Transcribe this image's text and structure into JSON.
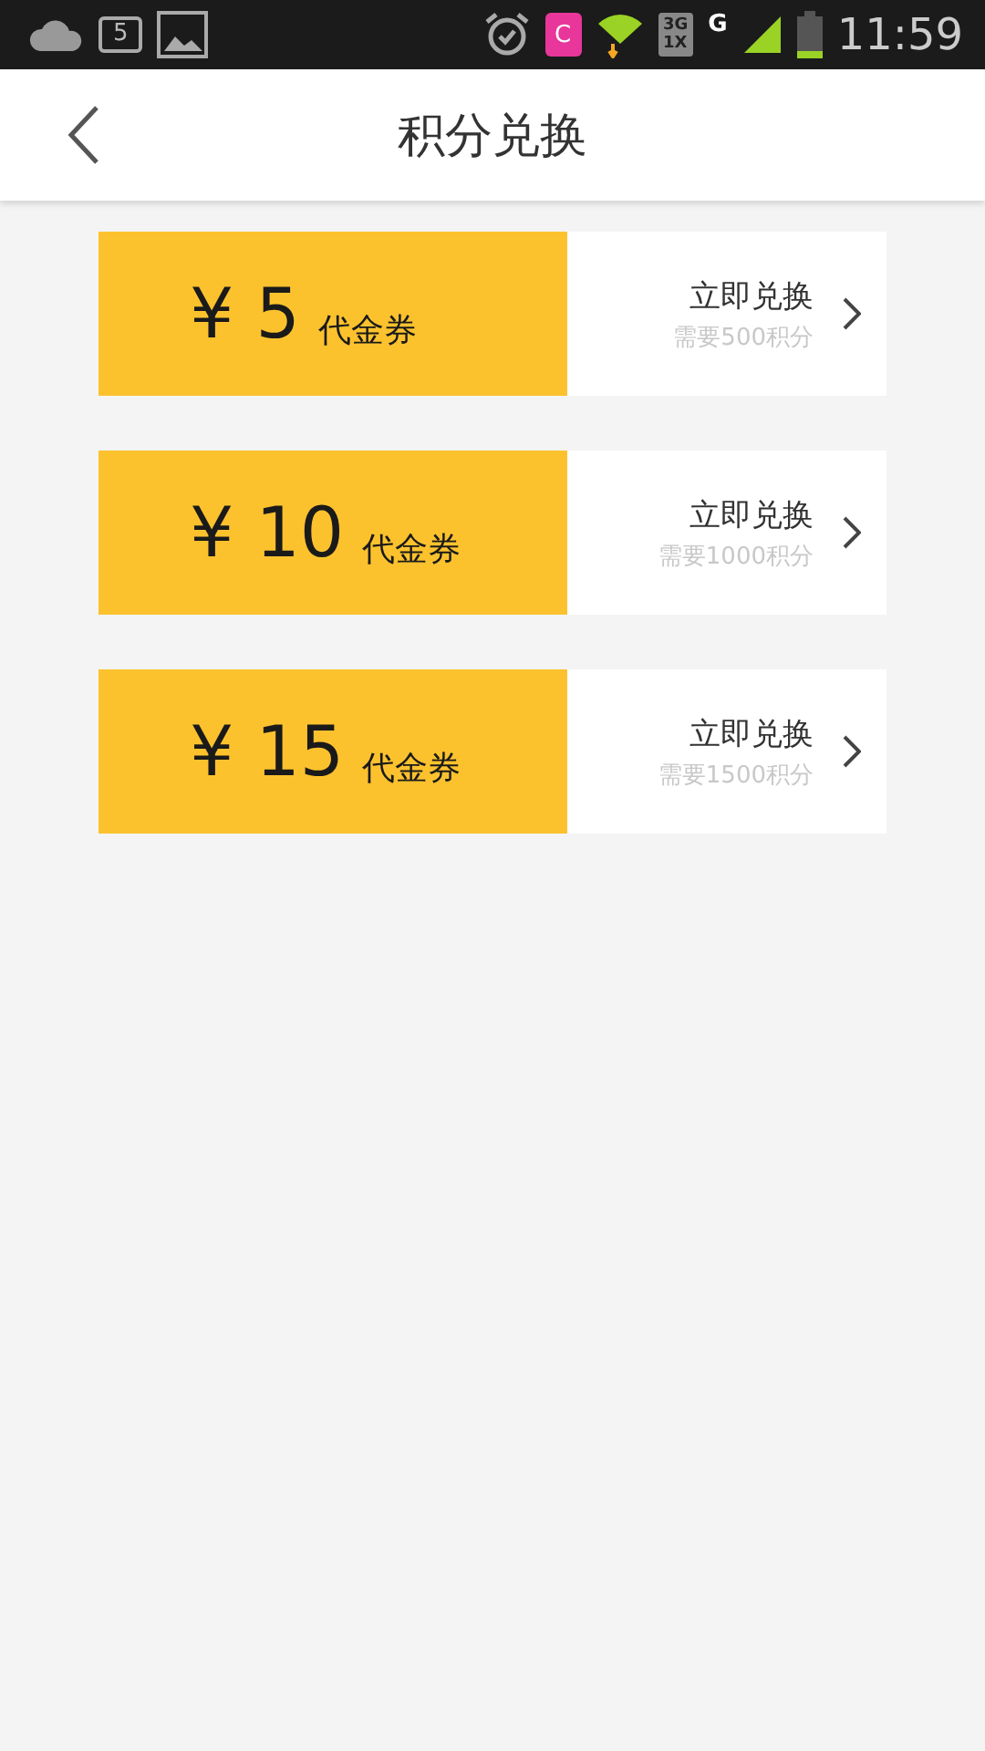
{
  "status_bar": {
    "notification_count": "5",
    "app_badge": "C",
    "network_3g": "3G",
    "network_1x": "1X",
    "network_g": "G",
    "time": "11:59"
  },
  "header": {
    "title": "积分兑换"
  },
  "vouchers": [
    {
      "amount": "¥ 5",
      "label": "代金券",
      "action": "立即兑换",
      "cost": "需要500积分"
    },
    {
      "amount": "¥ 10",
      "label": "代金券",
      "action": "立即兑换",
      "cost": "需要1000积分"
    },
    {
      "amount": "¥ 15",
      "label": "代金券",
      "action": "立即兑换",
      "cost": "需要1500积分"
    }
  ]
}
